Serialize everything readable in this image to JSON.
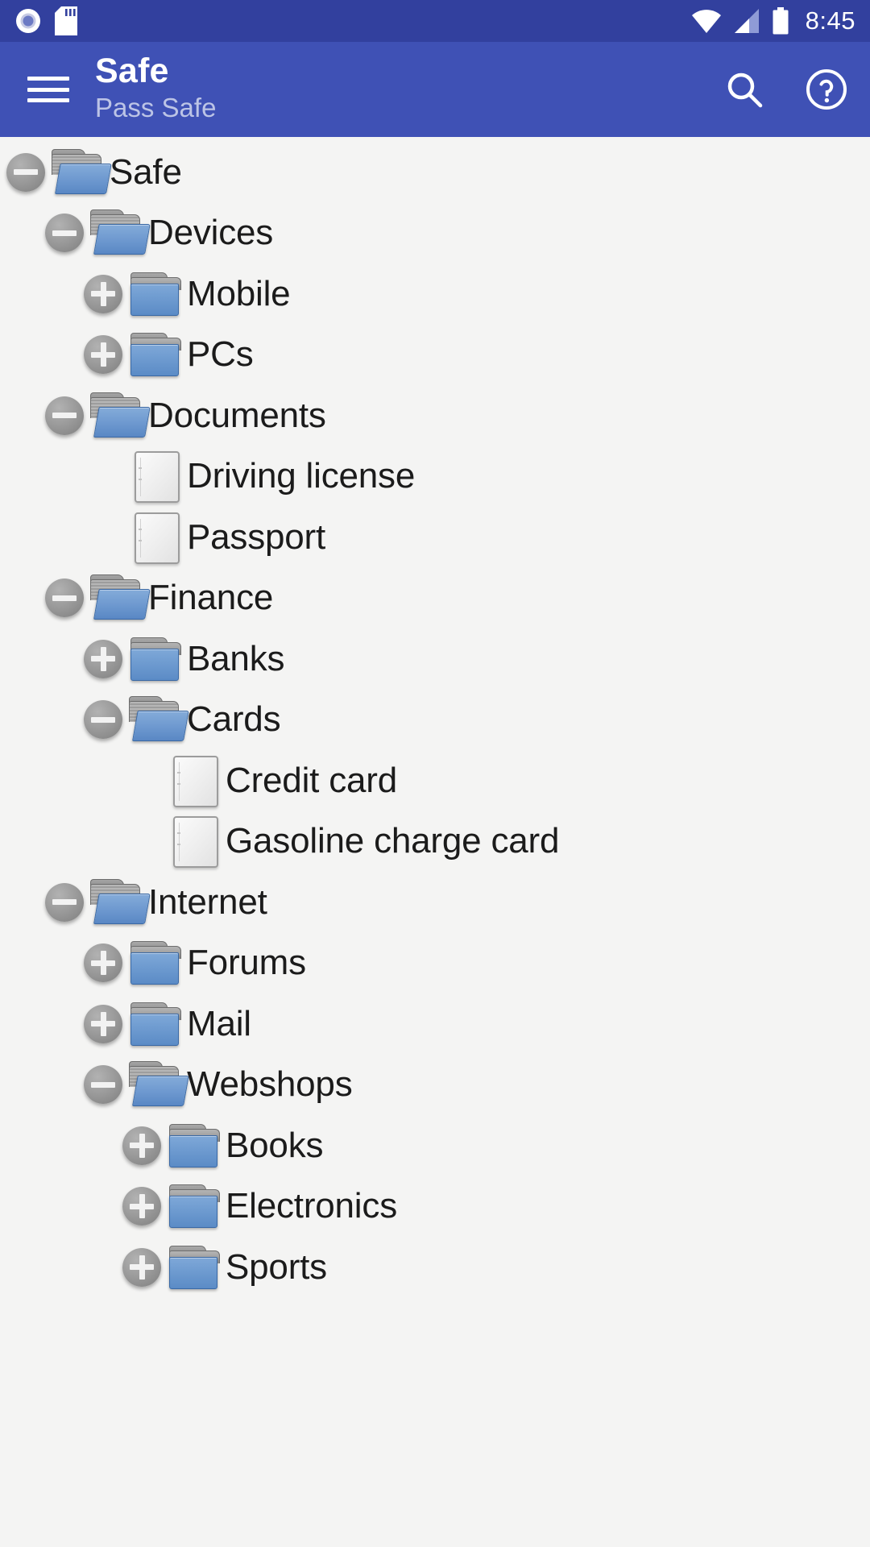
{
  "statusbar": {
    "time": "8:45",
    "icons": [
      "record-circle-icon",
      "sd-card-icon",
      "wifi-icon",
      "cellular-signal-icon",
      "battery-icon"
    ]
  },
  "appbar": {
    "menu_icon": "hamburger-menu-icon",
    "title": "Safe",
    "subtitle": "Pass Safe",
    "search_icon": "search-icon",
    "help_icon": "help-circle-icon",
    "background_color": "#3f51b5"
  },
  "colors": {
    "statusbar": "#32409e",
    "appbar": "#3f51b5",
    "page_background": "#f4f4f3",
    "label_text": "#1b1b1b",
    "subtitle_text": "#bcc4e6",
    "folder_blue": "#6e9bd0",
    "expander_gray": "#9a9a9a"
  },
  "tree": {
    "items": [
      {
        "label": "Safe",
        "depth": 0,
        "type": "folder-open",
        "state": "expanded"
      },
      {
        "label": "Devices",
        "depth": 1,
        "type": "folder-open",
        "state": "expanded"
      },
      {
        "label": "Mobile",
        "depth": 2,
        "type": "folder-closed",
        "state": "collapsed"
      },
      {
        "label": "PCs",
        "depth": 2,
        "type": "folder-closed",
        "state": "collapsed"
      },
      {
        "label": "Documents",
        "depth": 1,
        "type": "folder-open",
        "state": "expanded"
      },
      {
        "label": "Driving license",
        "depth": 2,
        "type": "file",
        "state": "leaf"
      },
      {
        "label": "Passport",
        "depth": 2,
        "type": "file",
        "state": "leaf"
      },
      {
        "label": "Finance",
        "depth": 1,
        "type": "folder-open",
        "state": "expanded"
      },
      {
        "label": "Banks",
        "depth": 2,
        "type": "folder-closed",
        "state": "collapsed"
      },
      {
        "label": "Cards",
        "depth": 2,
        "type": "folder-open",
        "state": "expanded"
      },
      {
        "label": "Credit card",
        "depth": 3,
        "type": "file",
        "state": "leaf"
      },
      {
        "label": "Gasoline charge card",
        "depth": 3,
        "type": "file",
        "state": "leaf"
      },
      {
        "label": "Internet",
        "depth": 1,
        "type": "folder-open",
        "state": "expanded"
      },
      {
        "label": "Forums",
        "depth": 2,
        "type": "folder-closed",
        "state": "collapsed"
      },
      {
        "label": "Mail",
        "depth": 2,
        "type": "folder-closed",
        "state": "collapsed"
      },
      {
        "label": "Webshops",
        "depth": 2,
        "type": "folder-open",
        "state": "expanded"
      },
      {
        "label": "Books",
        "depth": 3,
        "type": "folder-closed",
        "state": "collapsed"
      },
      {
        "label": "Electronics",
        "depth": 3,
        "type": "folder-closed",
        "state": "collapsed"
      },
      {
        "label": "Sports",
        "depth": 3,
        "type": "folder-closed",
        "state": "collapsed"
      }
    ]
  }
}
